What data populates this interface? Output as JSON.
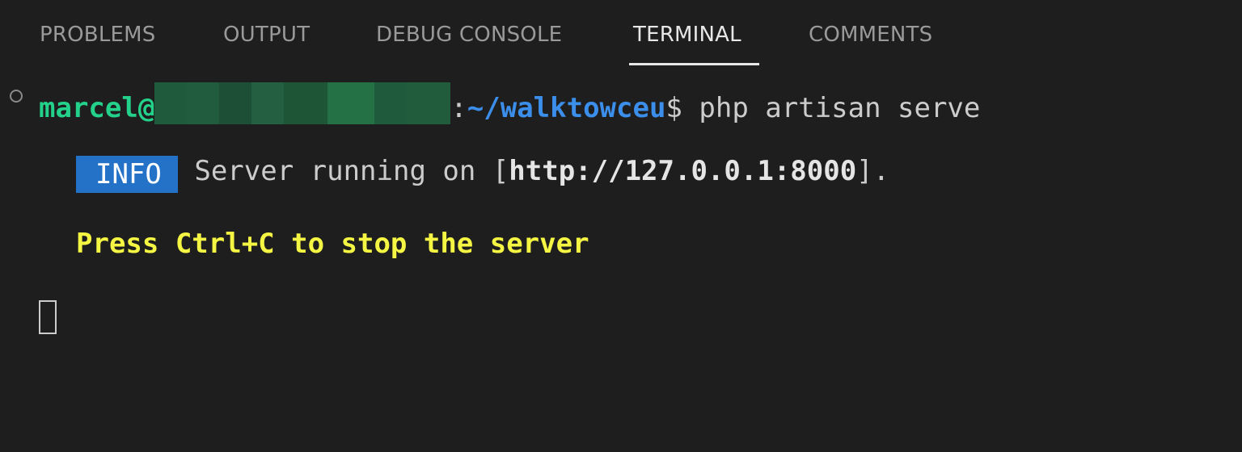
{
  "tabs": [
    {
      "label": "PROBLEMS",
      "active": false
    },
    {
      "label": "OUTPUT",
      "active": false
    },
    {
      "label": "DEBUG CONSOLE",
      "active": false
    },
    {
      "label": "TERMINAL",
      "active": true
    },
    {
      "label": "COMMENTS",
      "active": false
    }
  ],
  "terminal": {
    "prompt": {
      "user": "marcel@",
      "separator": ":",
      "path": "~/walktowceu",
      "symbol": "$",
      "command": " php artisan serve"
    },
    "info_line": {
      "badge": "INFO",
      "text_prefix": " Server running on [",
      "url": "http://127.0.0.1:8000",
      "text_suffix": "]."
    },
    "stop_hint": "Press Ctrl+C to stop the server"
  },
  "colors": {
    "background": "#1e1e1e",
    "prompt_user": "#23d18b",
    "prompt_path": "#3b8eea",
    "info_badge": "#2472c8",
    "hint_yellow": "#f5f543"
  }
}
